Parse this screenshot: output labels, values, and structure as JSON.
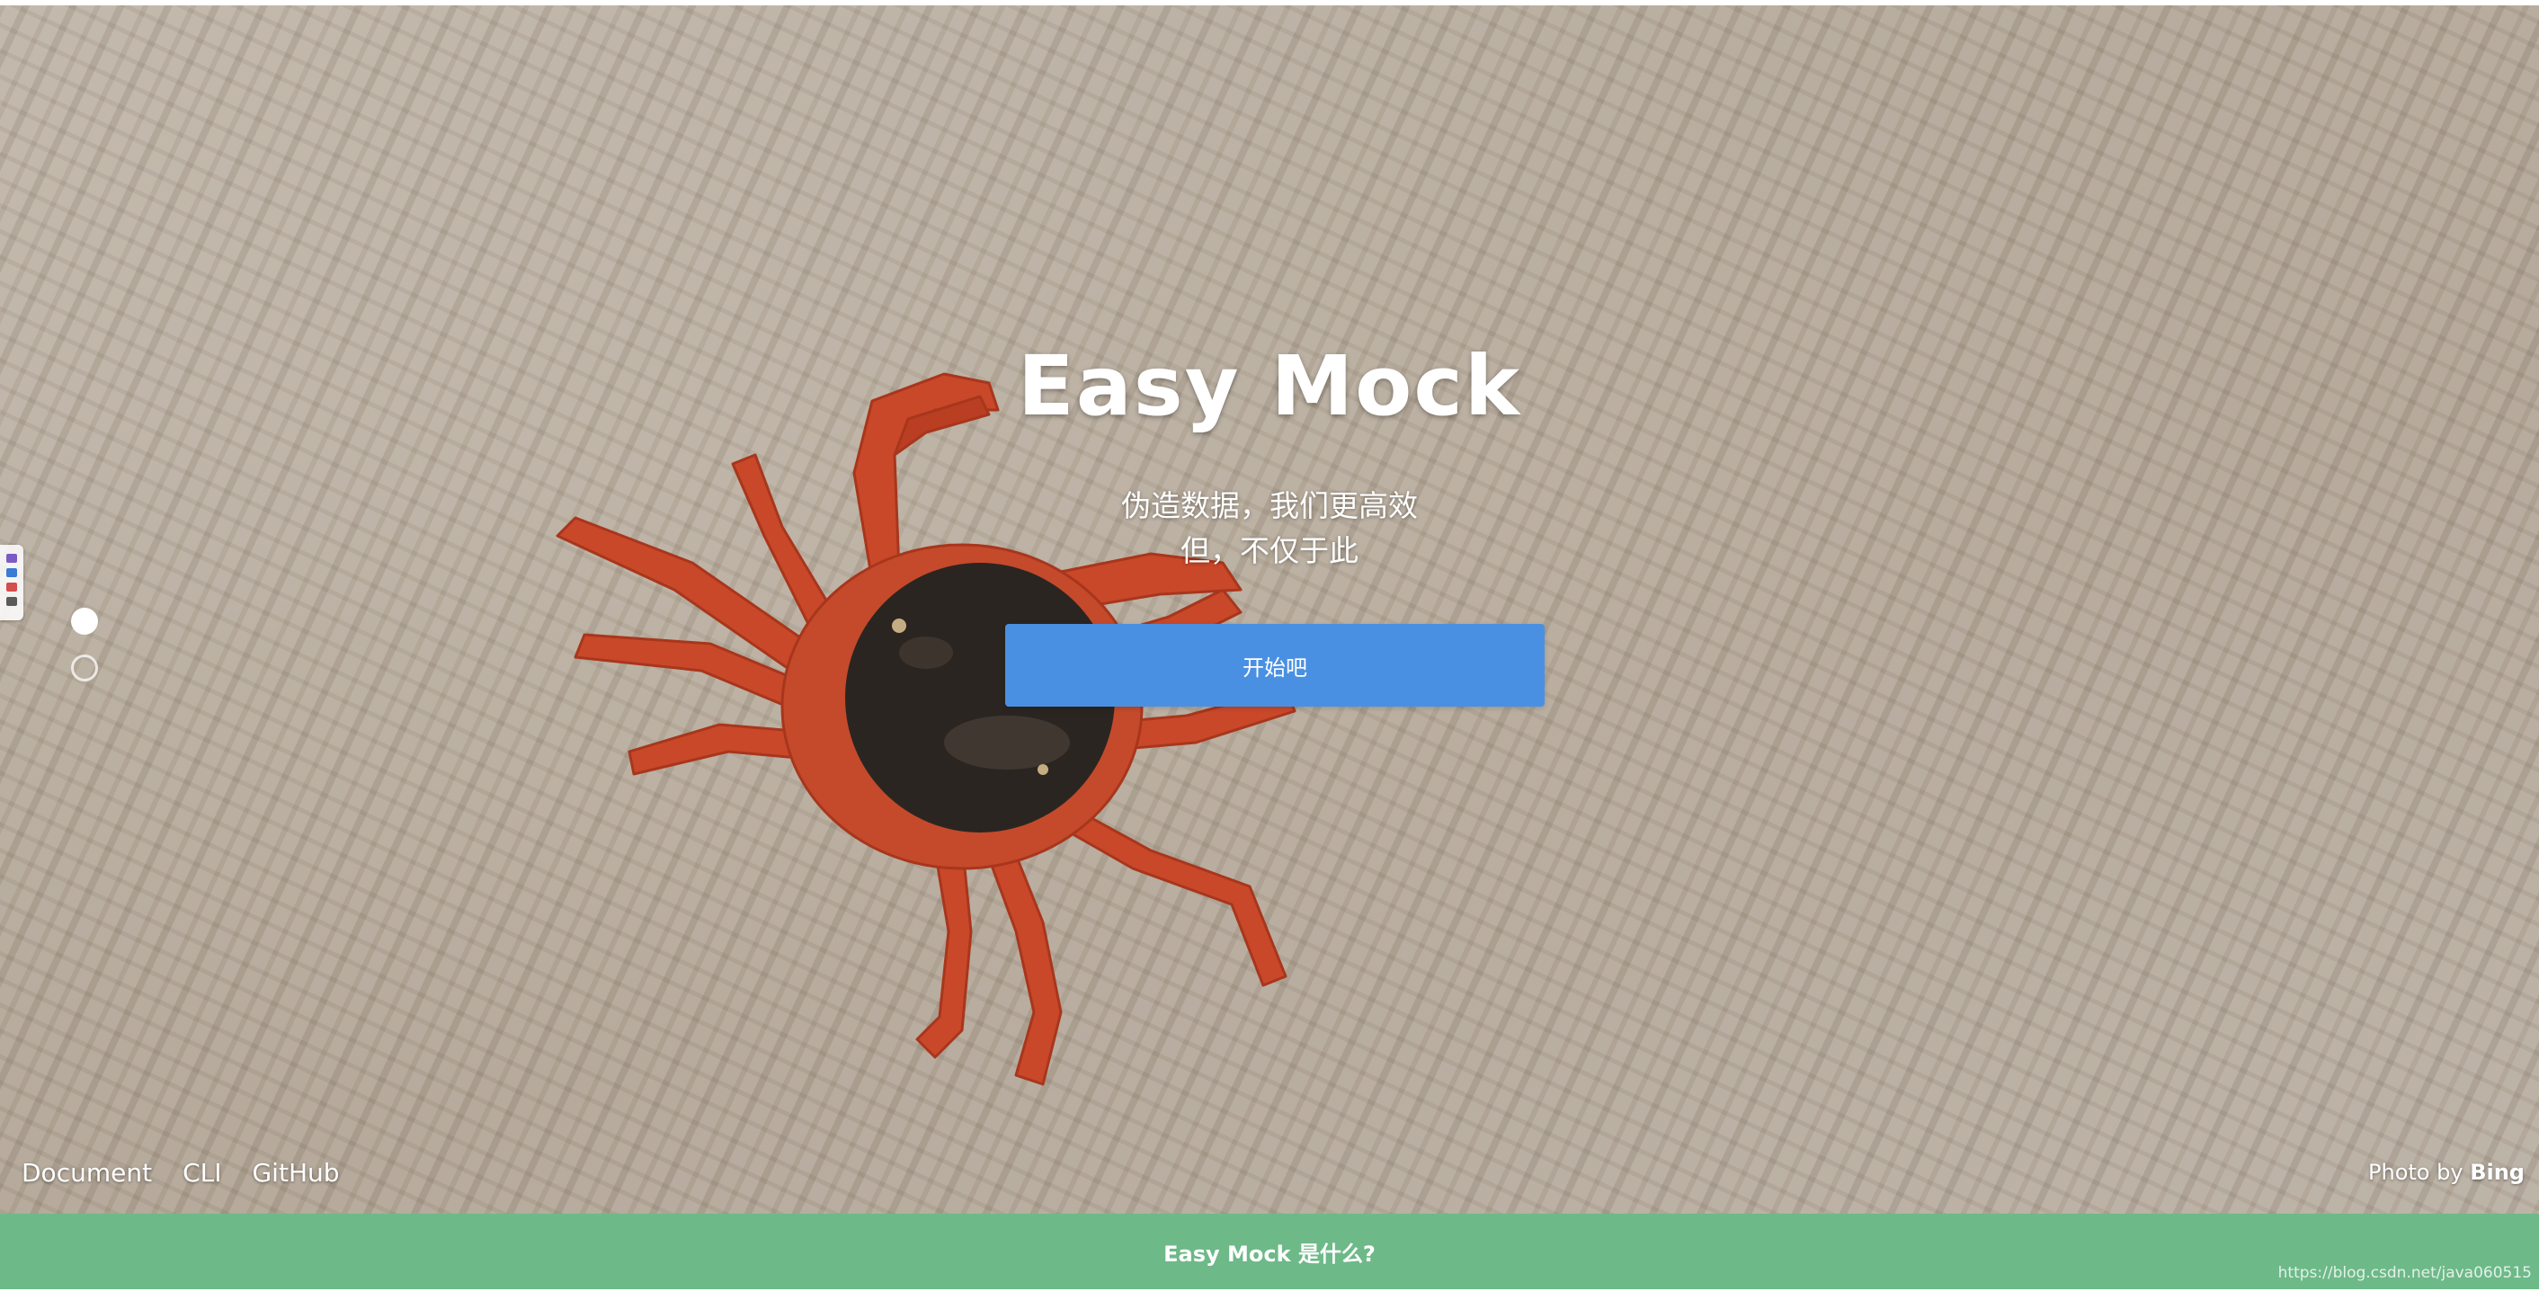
{
  "hero": {
    "title": "Easy Mock",
    "subtitle_line1": "伪造数据，我们更高效",
    "subtitle_line2": "但，不仅于此",
    "start_button_label": "开始吧"
  },
  "slider": {
    "dot_count": 2,
    "active_index": 0
  },
  "footer": {
    "links": [
      "Document",
      "CLI",
      "GitHub"
    ],
    "photo_by_label": "Photo by",
    "photo_source": "Bing"
  },
  "bottom_bar": {
    "label": "Easy Mock 是什么?"
  },
  "watermark": {
    "text": "https://blog.csdn.net/java060515"
  },
  "colors": {
    "button": "#4a90e2",
    "bottom_bar": "#6db988",
    "crab_shell": "#c9482a",
    "crab_dark": "#2b2521"
  }
}
